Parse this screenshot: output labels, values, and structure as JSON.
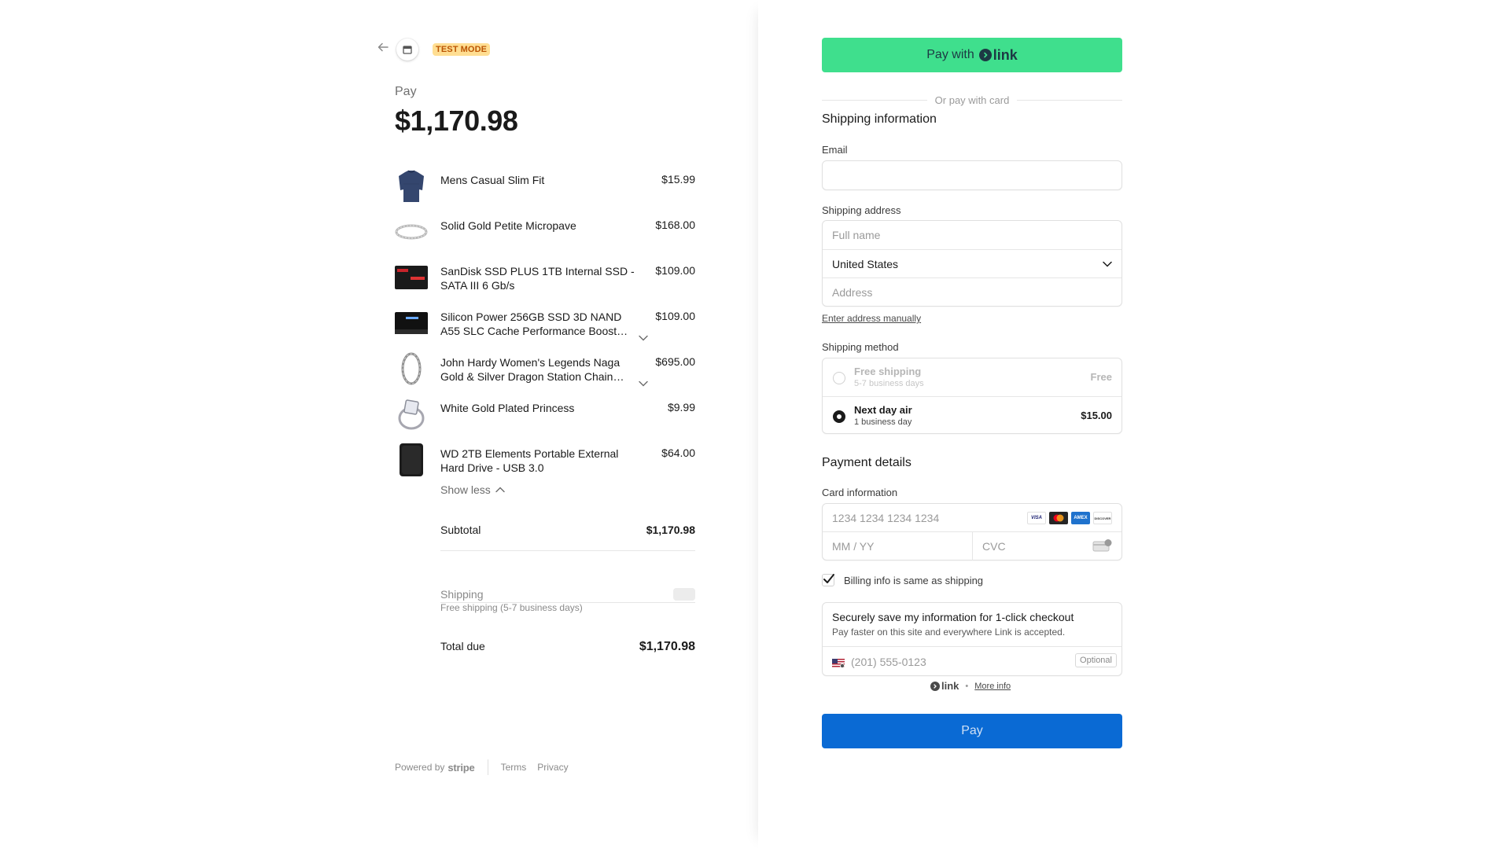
{
  "header": {
    "test_mode_badge": "TEST MODE"
  },
  "summary": {
    "pay_label": "Pay",
    "amount": "$1,170.98",
    "items": [
      {
        "name": "Mens Casual Slim Fit",
        "price": "$15.99",
        "icon": "shirt-thumbnail"
      },
      {
        "name": "Solid Gold Petite Micropave",
        "price": "$168.00",
        "icon": "bracelet-thumbnail"
      },
      {
        "name": "SanDisk SSD PLUS 1TB Internal SSD - SATA III 6 Gb/s",
        "price": "$109.00",
        "icon": "ssd-thumbnail"
      },
      {
        "name": "Silicon Power 256GB SSD 3D NAND A55 SLC Cache Performance Boost…",
        "price": "$109.00",
        "icon": "ssd-thumbnail"
      },
      {
        "name": "John Hardy Women's Legends Naga Gold & Silver Dragon Station Chain…",
        "price": "$695.00",
        "icon": "bracelet-thumbnail"
      },
      {
        "name": "White Gold Plated Princess",
        "price": "$9.99",
        "icon": "ring-thumbnail"
      },
      {
        "name": "WD 2TB Elements Portable External Hard Drive - USB 3.0",
        "price": "$64.00",
        "icon": "hard-drive-thumbnail"
      }
    ],
    "show_less": "Show less",
    "subtotal_label": "Subtotal",
    "subtotal_value": "$1,170.98",
    "shipping_label": "Shipping",
    "shipping_sub": "Free shipping (5-7 business days)",
    "total_label": "Total due",
    "total_value": "$1,170.98"
  },
  "footer": {
    "powered_by": "Powered by",
    "brand": "stripe",
    "terms": "Terms",
    "privacy": "Privacy"
  },
  "checkout": {
    "link_button_prefix": "Pay with",
    "link_word": "link",
    "or_pay_with_card": "Or pay with card",
    "shipping_heading": "Shipping information",
    "email_label": "Email",
    "email_value": "",
    "shipping_address_label": "Shipping address",
    "full_name_placeholder": "Full name",
    "country_value": "United States",
    "address_placeholder": "Address",
    "enter_manually": "Enter address manually",
    "shipping_method_label": "Shipping method",
    "methods": [
      {
        "name": "Free shipping",
        "sub": "5-7 business days",
        "price": "Free",
        "selected": false
      },
      {
        "name": "Next day air",
        "sub": "1 business day",
        "price": "$15.00",
        "selected": true
      }
    ],
    "payment_heading": "Payment details",
    "card_info_label": "Card information",
    "card_number_placeholder": "1234 1234 1234 1234",
    "card_brands": [
      "VISA",
      "mastercard",
      "AMEX",
      "DISCOVER"
    ],
    "expiry_placeholder": "MM / YY",
    "cvc_placeholder": "CVC",
    "billing_same": "Billing info is same as shipping",
    "billing_same_checked": true,
    "save_title": "Securely save my information for 1-click checkout",
    "save_sub": "Pay faster on this site and everywhere Link is accepted.",
    "phone_placeholder": "(201) 555-0123",
    "optional_tag": "Optional",
    "link_word_small": "link",
    "more_info": "More info",
    "pay_button": "Pay"
  },
  "colors": {
    "link_green": "#3fdf8d",
    "pay_blue": "#0a6ad4",
    "test_badge_bg": "#ffde92",
    "test_badge_text": "#bb5504"
  }
}
